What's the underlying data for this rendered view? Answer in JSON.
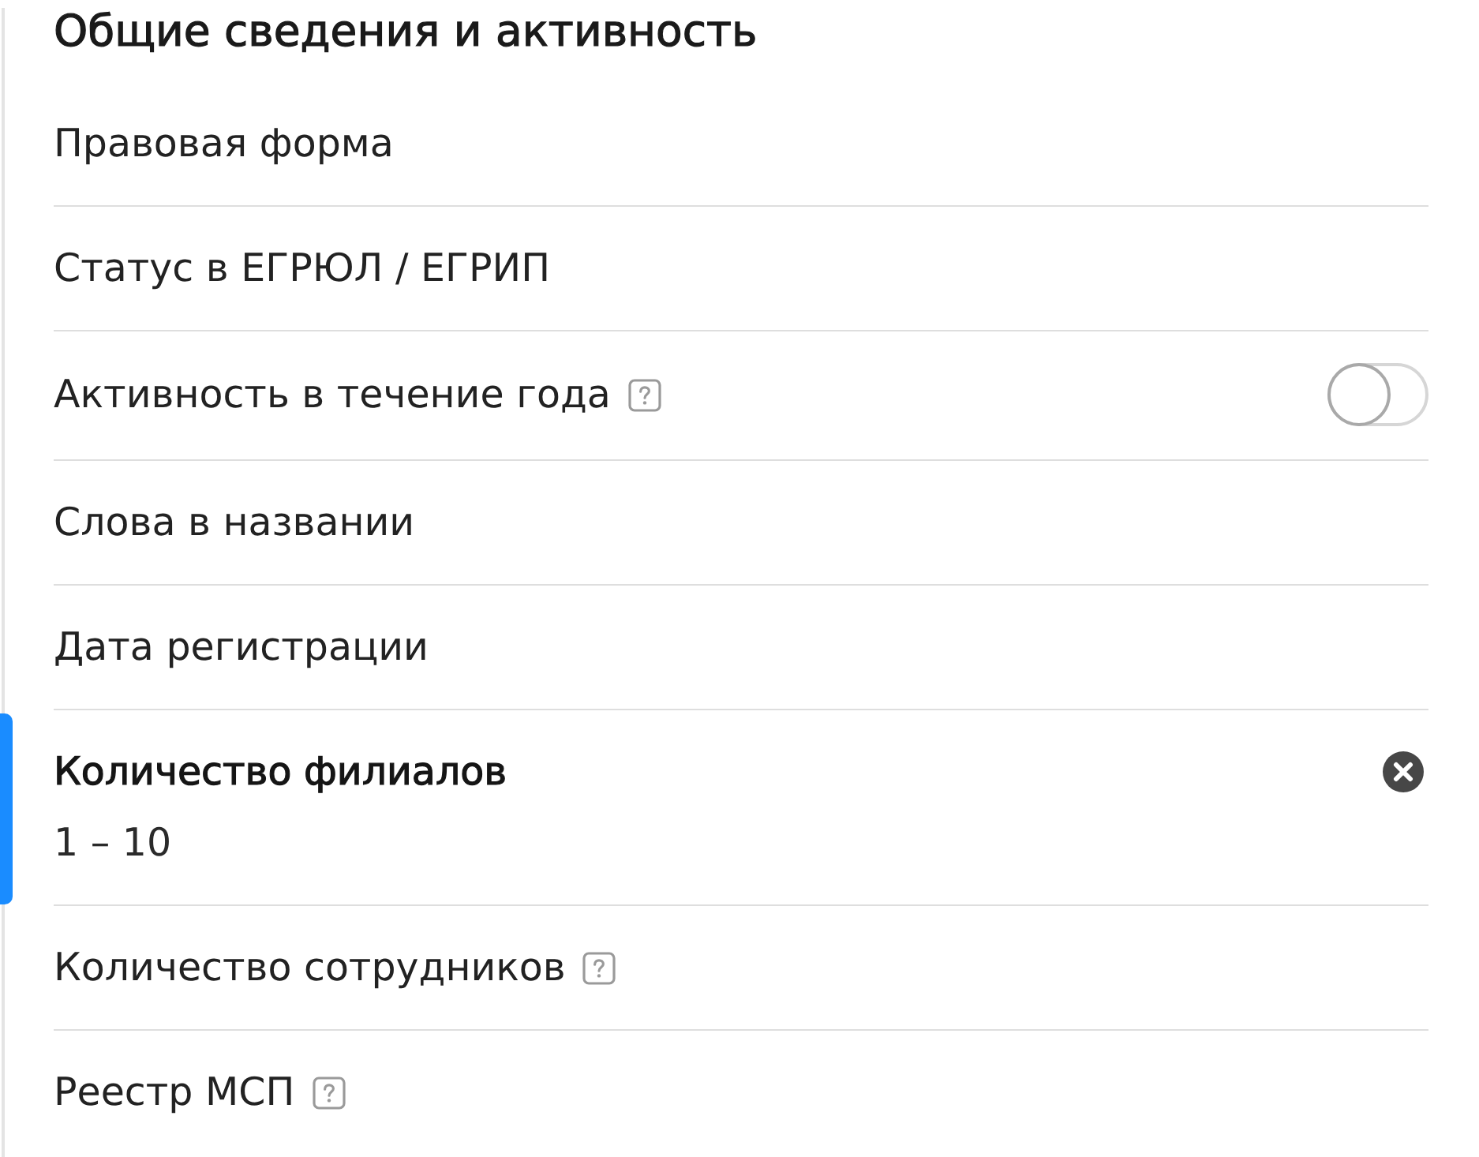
{
  "section": {
    "title": "Общие сведения и активность"
  },
  "filters": [
    {
      "kind": "plain",
      "label": "Правовая форма",
      "help": false,
      "selected": false
    },
    {
      "kind": "plain",
      "label": "Статус в ЕГРЮЛ / ЕГРИП",
      "help": false,
      "selected": false
    },
    {
      "kind": "switch",
      "label": "Активность в течение года",
      "help": true,
      "selected": false,
      "on": false
    },
    {
      "kind": "plain",
      "label": "Слова в названии",
      "help": false,
      "selected": false
    },
    {
      "kind": "plain",
      "label": "Дата регистрации",
      "help": false,
      "selected": false
    },
    {
      "kind": "value",
      "label": "Количество филиалов",
      "help": false,
      "selected": true,
      "value": "1 – 10"
    },
    {
      "kind": "plain",
      "label": "Количество сотрудников",
      "help": true,
      "selected": false
    },
    {
      "kind": "plain",
      "label": "Реестр МСП",
      "help": true,
      "selected": false
    }
  ]
}
